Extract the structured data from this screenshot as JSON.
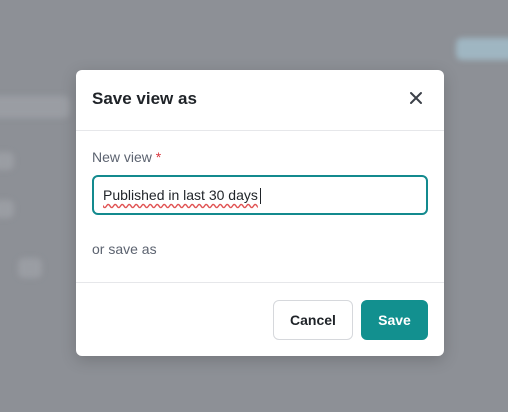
{
  "dialog": {
    "title": "Save view as",
    "close_icon": "close-icon",
    "field_label": "New view",
    "required_marker": "*",
    "input_value": "Published in last 30 days",
    "secondary_text": "or save as",
    "cancel_label": "Cancel",
    "save_label": "Save"
  },
  "colors": {
    "accent": "#12908f",
    "focus_border": "#138a8e",
    "required": "#d9363e",
    "backdrop": "#8d9096"
  }
}
